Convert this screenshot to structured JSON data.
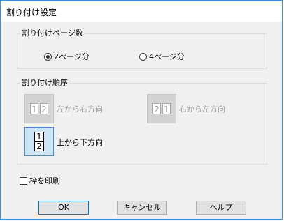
{
  "window": {
    "title": "割り付け設定"
  },
  "pages_group": {
    "label": "割り付けページ数",
    "options": [
      {
        "label": "2ページ分",
        "selected": true
      },
      {
        "label": "4ページ分",
        "selected": false
      }
    ]
  },
  "order_group": {
    "label": "割り付け順序",
    "options": [
      {
        "label": "左から右方向",
        "pages": [
          "1",
          "2"
        ],
        "enabled": false,
        "selected": false
      },
      {
        "label": "右から左方向",
        "pages": [
          "2",
          "1"
        ],
        "enabled": false,
        "selected": false
      },
      {
        "label": "上から下方向",
        "pages": [
          "1",
          "2"
        ],
        "enabled": true,
        "selected": true
      }
    ]
  },
  "frame_checkbox": {
    "label": "枠を印刷",
    "checked": false
  },
  "buttons": {
    "ok": "OK",
    "cancel": "キャンセル",
    "help": "ヘルプ"
  }
}
